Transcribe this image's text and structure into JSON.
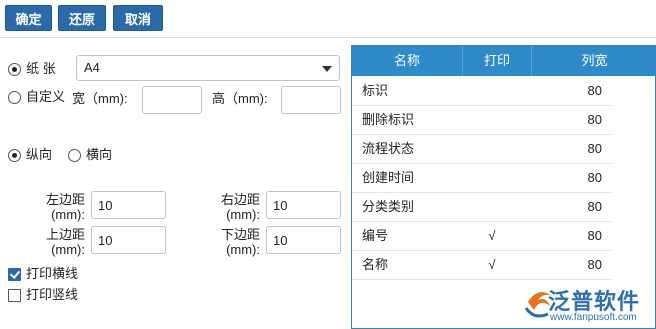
{
  "toolbar": {
    "confirm": "确定",
    "restore": "还原",
    "cancel": "取消"
  },
  "paper": {
    "label": "纸 张",
    "selected": "A4",
    "custom_label": "自定义",
    "width_label": "宽（mm):",
    "height_label": "高（mm):",
    "width_value": "",
    "height_value": ""
  },
  "orientation": {
    "portrait": "纵向",
    "landscape": "横向",
    "selected": "portrait"
  },
  "margins": {
    "left_label": "左边距\n(mm):",
    "left_value": "10",
    "right_label": "右边距\n(mm):",
    "right_value": "10",
    "top_label": "上边距\n(mm):",
    "top_value": "10",
    "bottom_label": "下边距\n(mm):",
    "bottom_value": "10"
  },
  "print_options": {
    "horizontal_lines": "打印横线",
    "horizontal_checked": true,
    "vertical_lines": "打印竖线",
    "vertical_checked": false
  },
  "columns_table": {
    "headers": [
      "名称",
      "打印",
      "列宽"
    ],
    "rows": [
      {
        "name": "标识",
        "print": "",
        "width": "80"
      },
      {
        "name": "删除标识",
        "print": "",
        "width": "80"
      },
      {
        "name": "流程状态",
        "print": "",
        "width": "80"
      },
      {
        "name": "创建时间",
        "print": "",
        "width": "80"
      },
      {
        "name": "分类类别",
        "print": "",
        "width": "80"
      },
      {
        "name": "编号",
        "print": "√",
        "width": "80"
      },
      {
        "name": "名称",
        "print": "√",
        "width": "80"
      }
    ]
  },
  "watermark": {
    "brand": "泛普软件",
    "url": "www.fanpusoft.com"
  },
  "colors": {
    "button": "#2a6aa8",
    "table_header": "#2e8ac8",
    "brand": "#2f6fb0"
  }
}
